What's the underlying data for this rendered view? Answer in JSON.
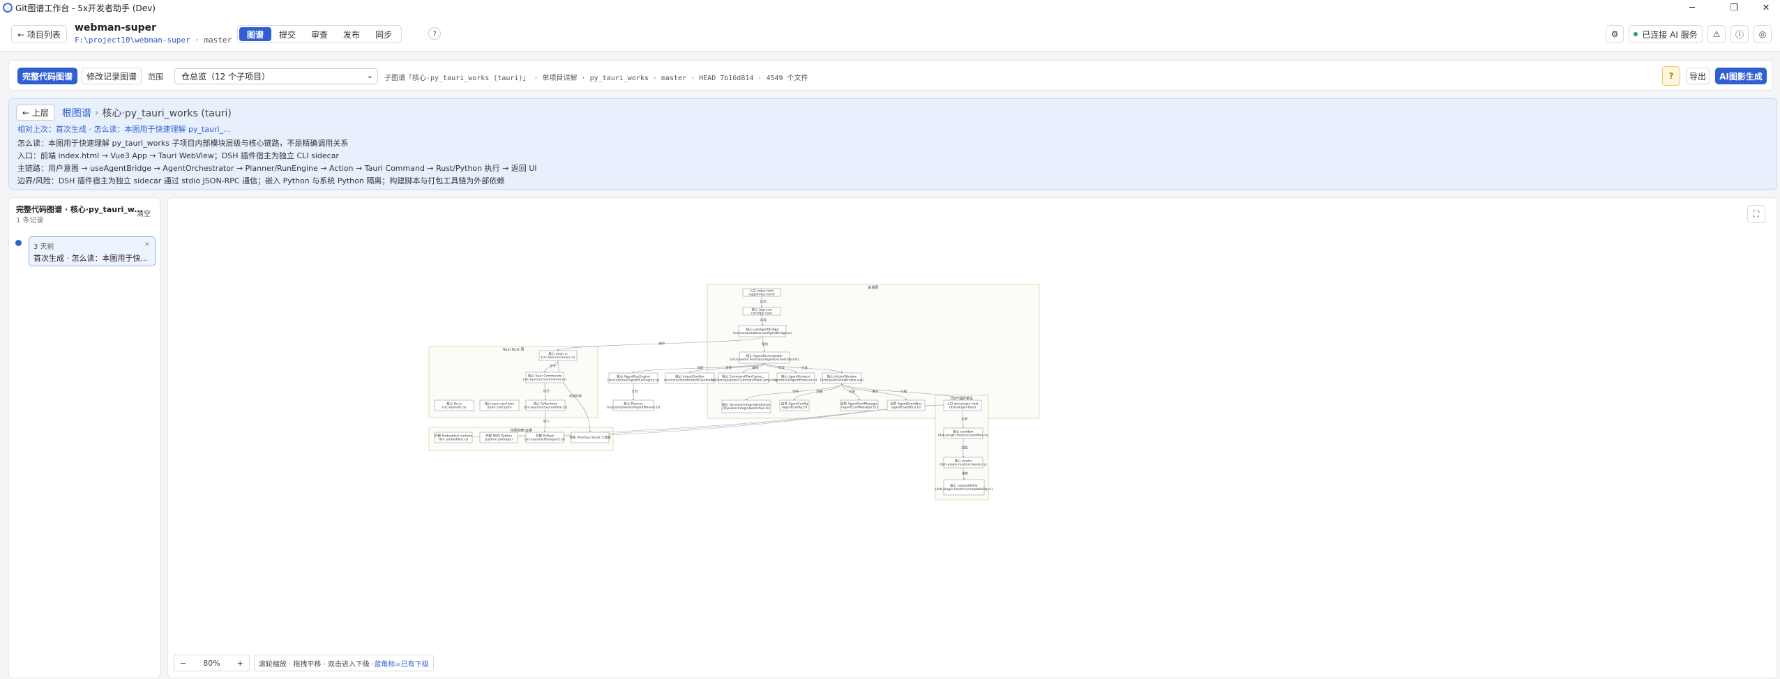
{
  "window": {
    "title": "Git图谱工作台 - 5x开发者助手 (Dev)"
  },
  "header": {
    "back_label": "← 项目列表",
    "project_name": "webman-super",
    "project_path": "F:\\project10\\webman-super",
    "project_sep": "·",
    "project_branch": "master",
    "tabs": [
      {
        "label": "图谱",
        "active": true
      },
      {
        "label": "提交"
      },
      {
        "label": "审查"
      },
      {
        "label": "发布"
      },
      {
        "label": "同步"
      }
    ],
    "ai_status": "已连接 AI 服务"
  },
  "toolbar": {
    "full_graph_label": "完整代码图谱",
    "history_graph_label": "修改记录图谱",
    "scope_label": "范围",
    "scope_value": "仓总览（12 个子项目）",
    "meta_text": "子图谱「核心·py_tauri_works (tauri)」 · 单项目详解 · py_tauri_works · master · HEAD 7b16d814 · 4549 个文件",
    "export_label": "导出",
    "ai_generate_label": "AI图影生成"
  },
  "info": {
    "up_label": "← 上层",
    "root_label": "根图谱",
    "crumb_sep": "›",
    "current_label": "核心·py_tauri_works (tauri)",
    "diff_text": "相对上次：首次生成 · 怎么读：本图用于快速理解 py_tauri_...",
    "lines": [
      "怎么读：本图用于快速理解 py_tauri_works 子项目内部模块层级与核心链路，不是精确调用关系",
      "入口：前端 index.html → Vue3 App → Tauri WebView；DSH 插件宿主为独立 CLI sidecar",
      "主链路：用户意图 → useAgentBridge → AgentOrchestrator → Planner/RunEngine → Action → Tauri Command → Rust/Python 执行 → 返回 UI",
      "边界/风险：DSH 插件宿主为独立 sidecar 通过 stdio JSON-RPC 通信；嵌入 Python 与系统 Python 隔离；构建脚本与打包工具链为外部依赖"
    ]
  },
  "sidebar": {
    "title": "完整代码图谱 · 核心·py_tauri_w...",
    "count": "1 条记录",
    "clear_label": "清空",
    "items": [
      {
        "time": "3 天前",
        "desc": "首次生成 · 怎么读：本图用于快..."
      }
    ]
  },
  "canvas": {
    "zoom_minus": "−",
    "zoom_level": "80%",
    "zoom_plus": "+",
    "hint_text": "滚轮缩放 · 拖拽平移 · 双击进入下级 · ",
    "hint_blue": "蓝角标=已有下级",
    "graph": {
      "groups": [
        "前端层",
        "Tauri Rust 层",
        "外部依赖/运维",
        "DSH 插件宿主"
      ],
      "nodes": [
        "入口 index.html (app/index.html)",
        "核心 App.vue (src/App.vue)",
        "核心 useAgentBridge (src/composables/useAgentBridge.ts)",
        "核心 AgentOrchestrator (src/core/orchestrator/AgentOrchestrator.ts)",
        "核心 AgentRunEngine (src/core/run/AgentRunEngine.ts)",
        "核心 IntentClarifier (src/core/intent/IntentClarifier.ts)",
        "核心 CommandPlanCompi... (src/core/planner/CommandPlanCompi.ts)",
        "核心 AgentProtocol (protocol/AgentProtocol.ts)",
        "核心 ActionWindow (Actions/ActionWindow.vue)",
        "核心 Planner (src/core/planner/AgentPlanner.ts)",
        "核心 DynamicIntegrationAction (DynamicIntegrationAction.ts)",
        "边界 AgentConfig (agentConfig.ts)",
        "边界 AgentConfManager (agentConfManager.ts)",
        "边界 AgentEventBus (agentEventBus.ts)",
        "核心 main.rs (src-tauri/src/main.rs)",
        "核心 Tauri Commands (src-tauri/src/commands.rs)",
        "核心 lib.rs (src-tauri/lib.rs)",
        "核心 tauri.conf.json (tauri.conf.json)",
        "核心 PyRuntime (src-tauri/src/py/runtime.rs)",
        "外部 Embedded runtime (bin_embedded.rs)",
        "外部 NSIS Python (python package)",
        "外部 PyRust (src-tauri/python/pyo3.rs)",
        "外部 Vite/Tauri Build 工具链",
        "入口 dsh-plugin-host (dsh-plugin-host)",
        "核心 sandbox (dsh-plugin-host/src/sandbox.rs)",
        "核心 loader (dsh-plugin-host/src/loader.rs)",
        "核心 compatibility (dsh-plugin-host/src/compatibility.rs)"
      ],
      "edges": [
        "启动",
        "挂载",
        "驱动",
        "调度",
        "编排",
        "澄清",
        "编译下发",
        "协议",
        "分发",
        "计划",
        "动作",
        "配置",
        "事件",
        "通知",
        "命令",
        "执行",
        "嵌入",
        "构建依赖",
        "注册",
        "加载",
        "兼容",
        "沙箱"
      ]
    }
  }
}
